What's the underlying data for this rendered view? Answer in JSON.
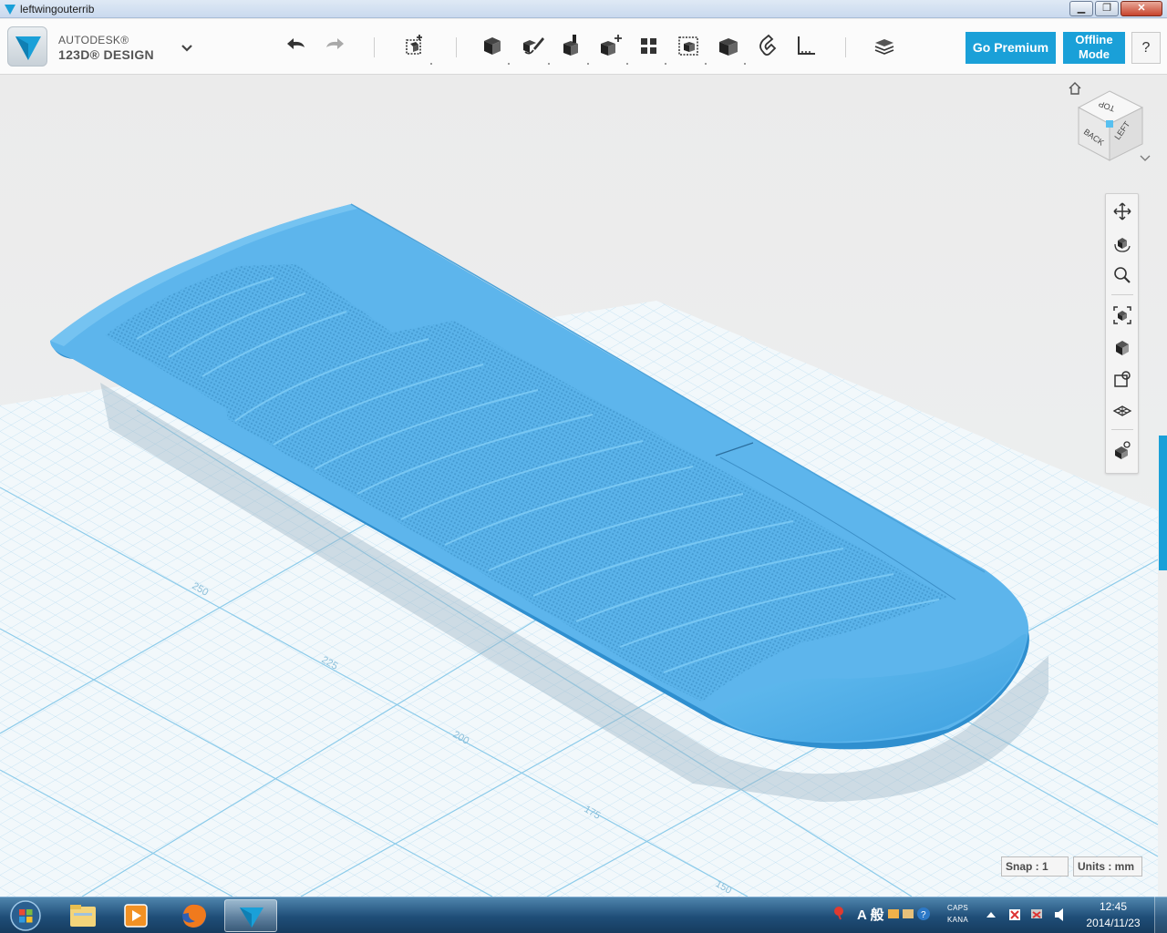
{
  "window": {
    "title": "leftwingouterrib",
    "min_label": "▁",
    "max_label": "❐",
    "close_label": "✕"
  },
  "app": {
    "brand_line1": "AUTODESK®",
    "brand_line2": "123D® DESIGN"
  },
  "toolbar": {
    "icons": [
      "undo-icon",
      "redo-icon",
      "primitives-icon",
      "sketch-icon",
      "construct-icon",
      "modify-icon",
      "pattern-icon",
      "grouping-icon",
      "combine-icon",
      "measure-icon",
      "snap-icon",
      "ruler-icon",
      "materials-icon",
      "layers-icon"
    ],
    "go_premium_label": "Go Premium",
    "offline_label": "Offline\nMode",
    "help_label": "?"
  },
  "viewcube": {
    "top_label": "TOP",
    "back_label": "BACK",
    "left_label": "LEFT"
  },
  "nav_tools": [
    "pan-icon",
    "orbit-icon",
    "zoom-icon",
    "fit-icon",
    "views-icon",
    "perspective-icon",
    "visibility-icon",
    "material-view-icon"
  ],
  "grid": {
    "labels": [
      "250",
      "225",
      "200",
      "175",
      "150"
    ]
  },
  "status": {
    "snap_label": "Snap : 1",
    "units_label": "Units : mm"
  },
  "colors": {
    "accent": "#1aa0d8",
    "model": "#58b3ea",
    "grid_line": "#b7d9ee",
    "grid_major": "#79bfe4"
  },
  "taskbar": {
    "items": [
      "start-button",
      "explorer-icon",
      "media-player-icon",
      "firefox-icon",
      "123d-design-icon"
    ],
    "ime_label": "A 般",
    "caps_label": "CAPS",
    "kana_label": "KANA",
    "time": "12:45",
    "date": "2014/11/23"
  }
}
